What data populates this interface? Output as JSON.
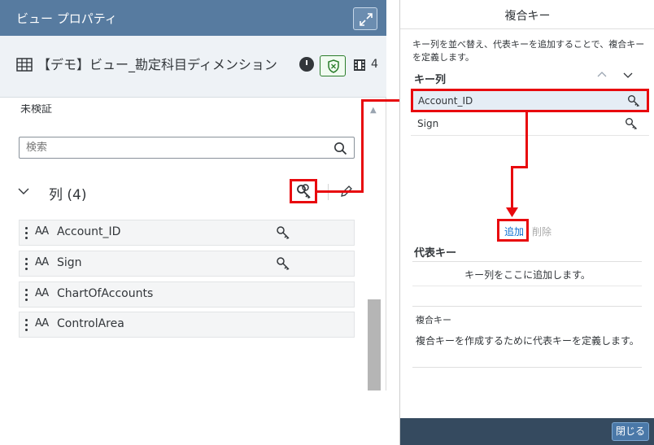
{
  "left_panel": {
    "header_title": "ビュー プロパティ",
    "view_name": "【デモ】ビュー_勘定科目ディメンション",
    "column_count_badge": "4",
    "status_text": "未検証",
    "search_placeholder": "検索",
    "columns_section_title": "列 (4)",
    "columns": [
      {
        "name": "Account_ID",
        "type_icon": "AA",
        "is_key": true
      },
      {
        "name": "Sign",
        "type_icon": "AA",
        "is_key": true
      },
      {
        "name": "ChartOfAccounts",
        "type_icon": "AA",
        "is_key": false
      },
      {
        "name": "ControlArea",
        "type_icon": "AA",
        "is_key": false
      }
    ]
  },
  "dialog": {
    "title": "複合キー",
    "description": "キー列を並べ替え、代表キーを追加することで、複合キーを定義します。",
    "key_columns_heading": "キー列",
    "key_columns": [
      "Account_ID",
      "Sign"
    ],
    "add_label": "追加",
    "remove_label": "削除",
    "representative_heading": "代表キー",
    "representative_placeholder": "キー列をここに追加します。",
    "composite_heading": "複合キー",
    "composite_description": "複合キーを作成するために代表キーを定義します。",
    "close_label": "閉じる"
  },
  "icons": {
    "expand": "expand-icon",
    "table": "table-icon",
    "clock": "clock-icon",
    "shield": "shield-icon",
    "film": "film-strip-icon",
    "search": "search-icon",
    "key": "key-icon",
    "edit": "pencil-icon",
    "chevron_down": "chevron-down-icon",
    "chevron_up": "chevron-up-icon"
  },
  "colors": {
    "header_bg": "#577ba0",
    "highlight_red": "#e8090e",
    "link_blue": "#0a6ed1",
    "footer_bg": "#354a5f",
    "selected_row_bg": "#e5edf5"
  }
}
